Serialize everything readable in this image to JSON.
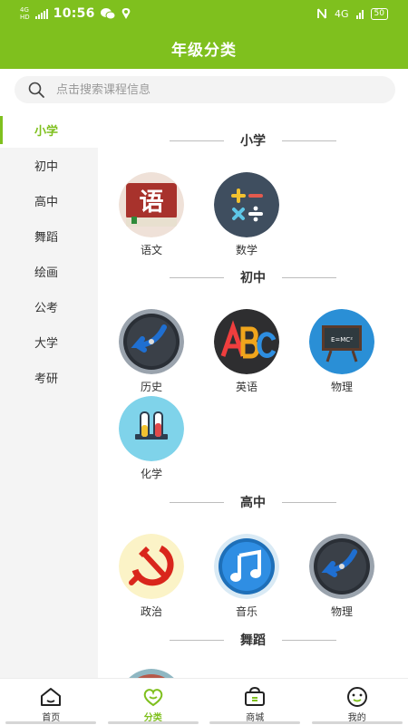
{
  "status_bar": {
    "network": "4G",
    "network_sub": "HD",
    "time": "10:56",
    "right_net": "4G",
    "battery": "50"
  },
  "header": {
    "title": "年级分类"
  },
  "search": {
    "placeholder": "点击搜索课程信息"
  },
  "sidebar": {
    "items": [
      {
        "label": "小学",
        "active": true
      },
      {
        "label": "初中"
      },
      {
        "label": "高中"
      },
      {
        "label": "舞蹈"
      },
      {
        "label": "绘画"
      },
      {
        "label": "公考"
      },
      {
        "label": "大学"
      },
      {
        "label": "考研"
      }
    ]
  },
  "sections": [
    {
      "title": "小学",
      "courses": [
        {
          "name": "语文",
          "icon": "chinese-book-icon"
        },
        {
          "name": "数学",
          "icon": "math-symbols-icon"
        }
      ]
    },
    {
      "title": "初中",
      "courses": [
        {
          "name": "历史",
          "icon": "clock-history-icon"
        },
        {
          "name": "英语",
          "icon": "abc-icon"
        },
        {
          "name": "物理",
          "icon": "blackboard-icon"
        },
        {
          "name": "化学",
          "icon": "test-tubes-icon"
        }
      ]
    },
    {
      "title": "高中",
      "courses": [
        {
          "name": "政治",
          "icon": "hammer-sickle-icon"
        },
        {
          "name": "音乐",
          "icon": "music-note-icon"
        },
        {
          "name": "物理",
          "icon": "clock-history-icon"
        }
      ]
    },
    {
      "title": "舞蹈",
      "courses": []
    }
  ],
  "sample_icon_text": {
    "chinese": "语",
    "formula": "E=MC²"
  },
  "tabbar": {
    "tabs": [
      {
        "label": "首页",
        "icon": "home-icon"
      },
      {
        "label": "分类",
        "icon": "heart-icon",
        "active": true
      },
      {
        "label": "商城",
        "icon": "shopping-bag-icon"
      },
      {
        "label": "我的",
        "icon": "smiley-icon"
      }
    ]
  },
  "colors": {
    "accent": "#7fc01e",
    "sidebar_bg": "#f4f4f4"
  }
}
